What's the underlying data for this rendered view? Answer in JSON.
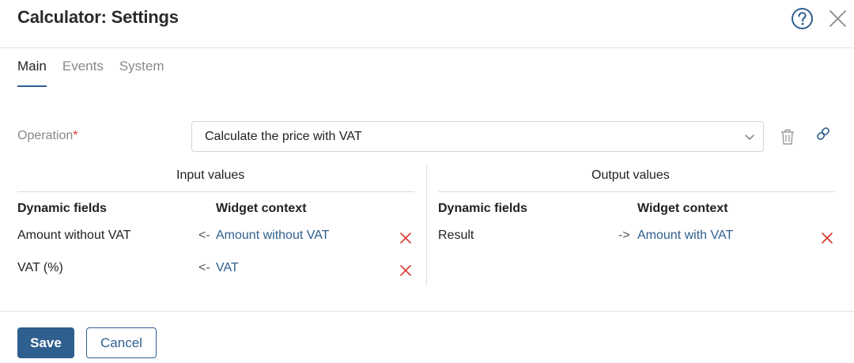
{
  "window": {
    "title": "Calculator: Settings"
  },
  "tabs": [
    {
      "label": "Main",
      "active": true
    },
    {
      "label": "Events",
      "active": false
    },
    {
      "label": "System",
      "active": false
    }
  ],
  "operation": {
    "label": "Operation",
    "required_mark": "*",
    "selected_value": "Calculate the price with VAT"
  },
  "input_values": {
    "heading": "Input values",
    "col_dynamic": "Dynamic fields",
    "col_context": "Widget context",
    "rows": [
      {
        "field": "Amount without VAT",
        "arrow": "<-",
        "context": "Amount without VAT"
      },
      {
        "field": "VAT (%)",
        "arrow": "<-",
        "context": "VAT"
      }
    ]
  },
  "output_values": {
    "heading": "Output values",
    "col_dynamic": "Dynamic fields",
    "col_context": "Widget context",
    "rows": [
      {
        "field": "Result",
        "arrow": "->",
        "context": "Amount with VAT"
      }
    ]
  },
  "footer": {
    "save_label": "Save",
    "cancel_label": "Cancel"
  },
  "colors": {
    "accent": "#2f5f8f",
    "delete": "#d9362e",
    "required": "#d9362e"
  },
  "icons": [
    "help-icon",
    "close-icon",
    "chevron-down-icon",
    "trash-icon",
    "link-icon",
    "delete-x-icon"
  ]
}
